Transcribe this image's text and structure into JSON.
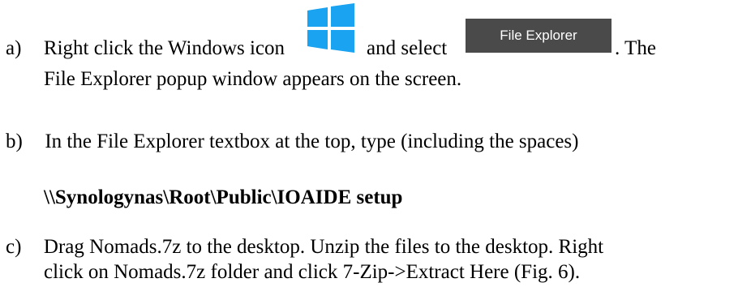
{
  "steps": [
    {
      "marker": "a)",
      "text_before_icon": "Right click the Windows icon",
      "text_between": "and select",
      "text_after_button": ". The",
      "continuation": "File Explorer popup window appears on the screen."
    },
    {
      "marker": "b)",
      "text": "In the File Explorer textbox at the top, type (including the spaces)",
      "path": "\\\\Synologynas\\Root\\Public\\IOAIDE setup"
    },
    {
      "marker": "c)",
      "text": "Drag Nomads.7z to the desktop. Unzip the files to the desktop. Right",
      "continuation": "click on Nomads.7z folder and click 7-Zip->Extract Here (Fig. 6)."
    }
  ],
  "icons": {
    "windows_icon": "windows-logo-icon",
    "windows_color": "#1aa3f0"
  },
  "button": {
    "label": "File Explorer",
    "background": "#4a4a4a"
  }
}
